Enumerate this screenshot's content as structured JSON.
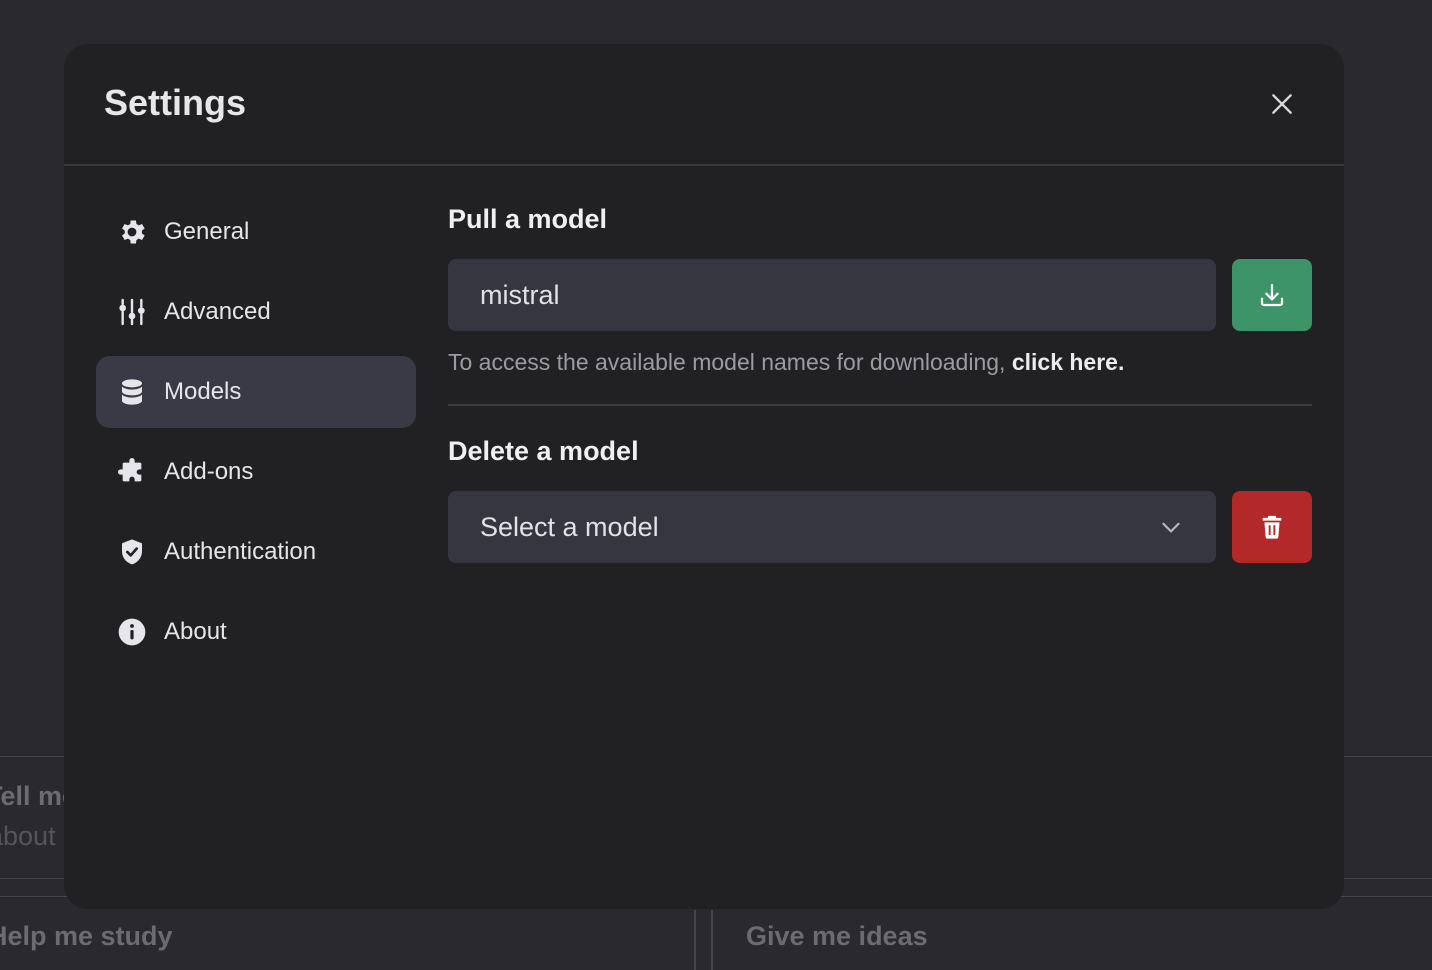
{
  "background": {
    "cards": [
      {
        "title": "Tell me",
        "subtitle": "about"
      },
      {
        "title": "Help me study",
        "subtitle": ""
      },
      {
        "title": "Give me ideas",
        "subtitle": ""
      }
    ]
  },
  "modal": {
    "title": "Settings",
    "close_icon": "close-icon"
  },
  "sidebar": {
    "items": [
      {
        "label": "General",
        "icon": "gear-icon",
        "active": false
      },
      {
        "label": "Advanced",
        "icon": "sliders-icon",
        "active": false
      },
      {
        "label": "Models",
        "icon": "database-icon",
        "active": true
      },
      {
        "label": "Add-ons",
        "icon": "puzzle-icon",
        "active": false
      },
      {
        "label": "Authentication",
        "icon": "shield-check-icon",
        "active": false
      },
      {
        "label": "About",
        "icon": "info-icon",
        "active": false
      }
    ]
  },
  "pull": {
    "title": "Pull a model",
    "input_value": "mistral",
    "button_icon": "download-icon",
    "hint_text": "To access the available model names for downloading, ",
    "hint_link": "click here."
  },
  "delete": {
    "title": "Delete a model",
    "select_value": "Select a model",
    "button_icon": "trash-icon"
  },
  "colors": {
    "download_button": "#3d9469",
    "delete_button": "#b32828",
    "active_nav": "#3a3a46"
  }
}
